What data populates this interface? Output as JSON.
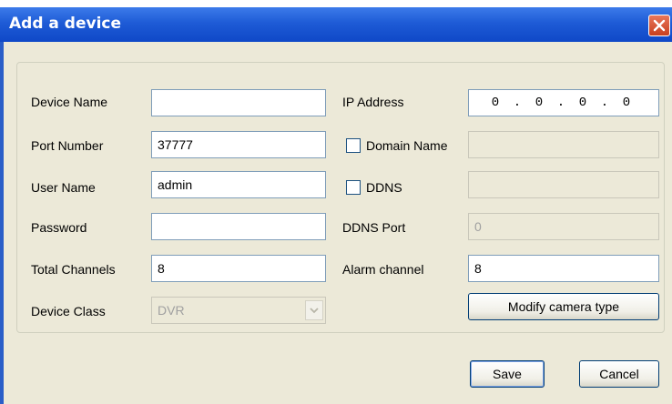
{
  "window": {
    "title": "Add a device",
    "close_icon": "close-icon",
    "close_color": "#e8765a"
  },
  "form": {
    "device_name": {
      "label": "Device Name",
      "value": ""
    },
    "port_number": {
      "label": "Port Number",
      "value": "37777"
    },
    "user_name": {
      "label": "User Name",
      "value": "admin"
    },
    "password": {
      "label": "Password",
      "value": ""
    },
    "total_channels": {
      "label": "Total Channels",
      "value": "8"
    },
    "device_class": {
      "label": "Device Class",
      "value": "DVR"
    },
    "ip_address": {
      "label": "IP Address",
      "octets": [
        "0",
        "0",
        "0",
        "0"
      ],
      "separator": "."
    },
    "domain_name": {
      "label": "Domain Name",
      "checked": false,
      "value": ""
    },
    "ddns": {
      "label": "DDNS",
      "checked": false,
      "value": ""
    },
    "ddns_port": {
      "label": "DDNS Port",
      "value": "0"
    },
    "alarm_channel": {
      "label": "Alarm channel",
      "value": "8"
    }
  },
  "buttons": {
    "modify_camera_type": "Modify camera type",
    "save": "Save",
    "cancel": "Cancel"
  }
}
